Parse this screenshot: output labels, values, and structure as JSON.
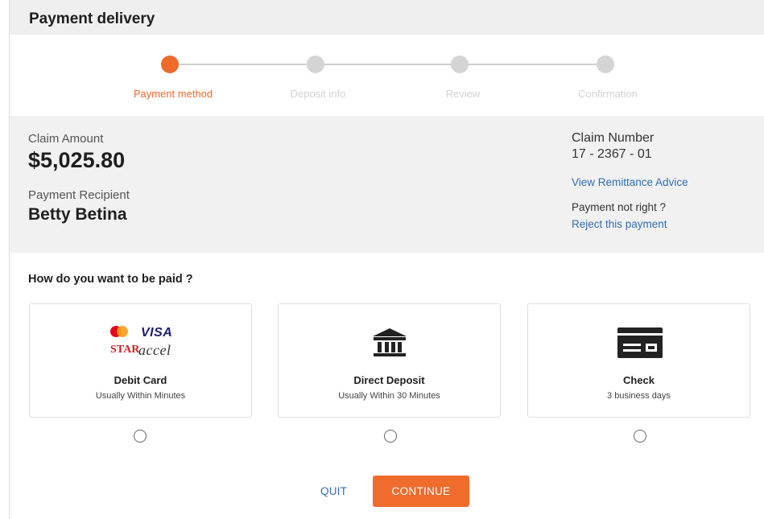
{
  "header": {
    "title": "Payment delivery"
  },
  "stepper": {
    "steps": [
      {
        "label": "Payment method",
        "active": true
      },
      {
        "label": "Deposit info",
        "active": false
      },
      {
        "label": "Review",
        "active": false
      },
      {
        "label": "Confirmation",
        "active": false
      }
    ]
  },
  "claim": {
    "amount_label": "Claim Amount",
    "amount": "$5,025.80",
    "recipient_label": "Payment Recipient",
    "recipient": "Betty Betina",
    "number_label": "Claim Number",
    "number": "17 - 2367 - 01",
    "remittance_link": "View Remittance Advice",
    "not_right_text": "Payment not right ?",
    "reject_link": "Reject this payment"
  },
  "payment": {
    "question": "How do you want to be paid ?",
    "options": [
      {
        "title": "Debit Card",
        "subtitle": "Usually Within Minutes",
        "icon": "card-network-logos",
        "logos": {
          "visa": "VISA",
          "star": "STAR",
          "accel": "accel"
        }
      },
      {
        "title": "Direct Deposit",
        "subtitle": "Usually Within 30 Minutes",
        "icon": "bank-icon"
      },
      {
        "title": "Check",
        "subtitle": "3 business days",
        "icon": "check-icon"
      }
    ]
  },
  "actions": {
    "quit": "QUIT",
    "continue": "CONTINUE"
  },
  "colors": {
    "accent": "#ee6a2b",
    "link": "#2f6fb3",
    "panel": "#f1f1f1",
    "inactive_step": "#d4d4d4"
  }
}
